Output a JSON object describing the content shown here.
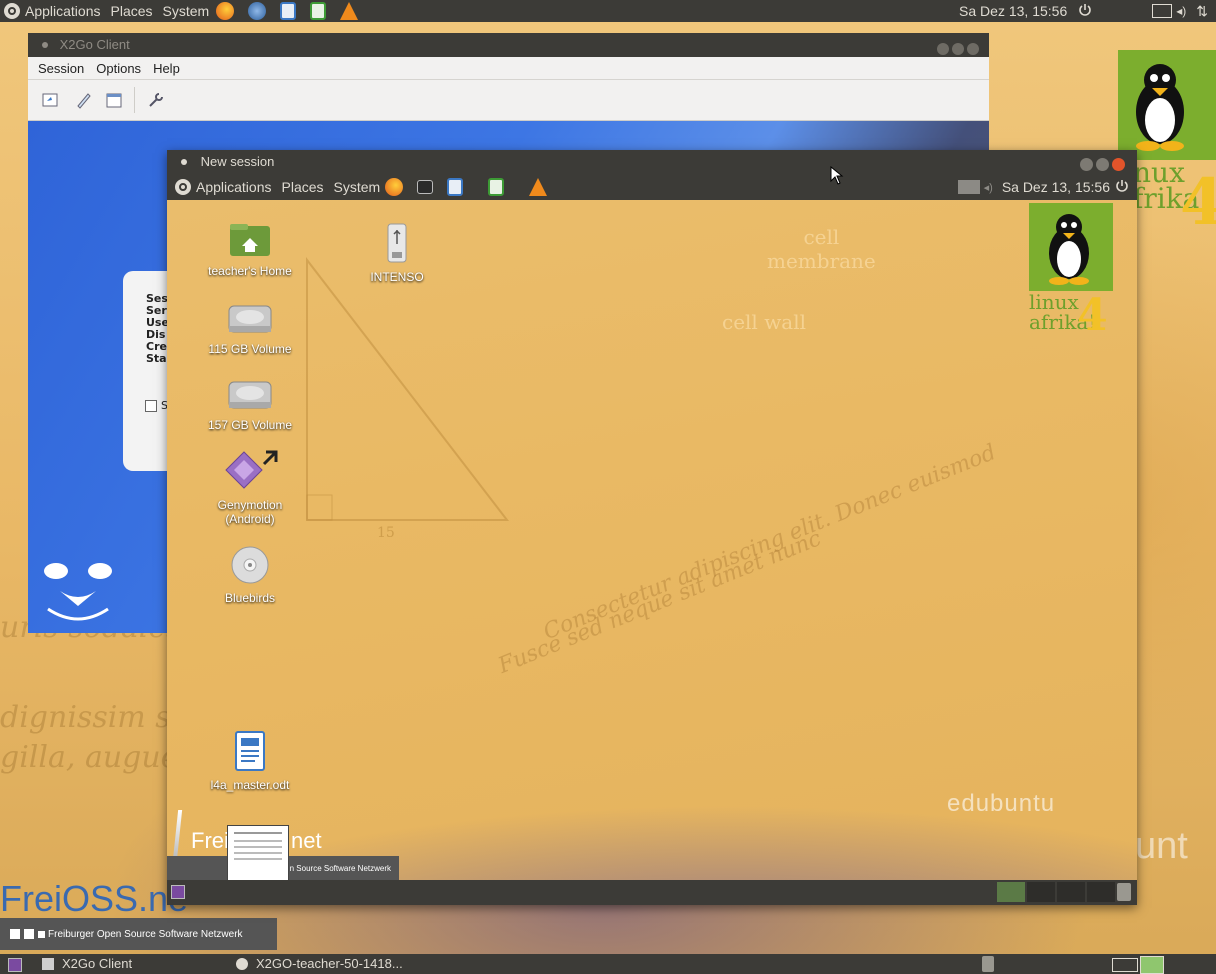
{
  "top_panel": {
    "menu_applications": "Applications",
    "menu_places": "Places",
    "menu_system": "System",
    "clock": "Sa Dez 13, 15:56",
    "launchers": [
      "firefox-icon",
      "thunderbird-icon",
      "writer-icon",
      "calc-icon",
      "vlc-icon"
    ]
  },
  "x2go_window": {
    "title": "X2Go Client",
    "menu": {
      "session": "Session",
      "options": "Options",
      "help": "Help"
    },
    "toolbar": [
      "new-session-icon",
      "edit-session-icon",
      "session-manager-icon",
      "settings-icon"
    ],
    "session_card_labels": [
      "Ses",
      "Ser",
      "Use",
      "Dis",
      "Cre",
      "Sta"
    ],
    "checkbox_label": "S"
  },
  "session_window": {
    "title": "New session",
    "panel": {
      "menu_applications": "Applications",
      "menu_places": "Places",
      "menu_system": "System",
      "clock": "Sa Dez 13, 15:56"
    },
    "desktop_icons": {
      "home": "teacher's Home",
      "usb": "INTENSO",
      "vol115": "115 GB Volume",
      "vol157": "157 GB Volume",
      "genymotion": "Genymotion\n(Android)",
      "bluebirds": "Bluebirds",
      "document": "l4a_master.odt"
    },
    "wallpaper_text": {
      "cell_membrane": "cell\nmembrane",
      "cell_wall": "cell wall",
      "edubuntu": "edubuntu",
      "linux": "linux",
      "afrika": "afrika!",
      "number": "4",
      "fifteen": "15"
    },
    "freioss_banner": "n Source Software Netzwerk"
  },
  "desktop": {
    "linux": "nux",
    "afrika": "frika!",
    "number": "4",
    "freioss": "FreiOSS.ne",
    "freioss_small": "Frei",
    "freioss_net": ".net",
    "banner": "Freiburger Open Source Software Netzwerk",
    "edubuntu_fragment": "unt"
  },
  "taskbar": {
    "task1": "X2Go Client",
    "task2": "X2GO-teacher-50-1418..."
  }
}
